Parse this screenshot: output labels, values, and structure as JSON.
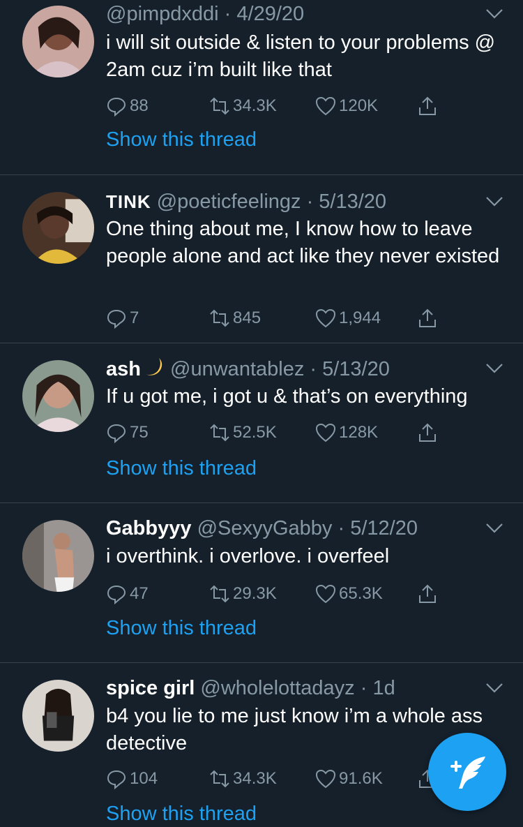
{
  "tweets": [
    {
      "name": "",
      "handle": "@pimpdxddi",
      "date": "4/29/20",
      "text": "i will sit outside & listen to your problems @ 2am cuz i’m built like that",
      "replies": "88",
      "retweets": "34.3K",
      "likes": "120K",
      "thread": "Show this thread"
    },
    {
      "name": "TINK",
      "handle": "@poeticfeelingz",
      "date": "5/13/20",
      "text": "One thing about me, I know how to leave people alone and act like they never existed",
      "replies": "7",
      "retweets": "845",
      "likes": "1,944",
      "thread": ""
    },
    {
      "name": "ash",
      "handle": "@unwantablez",
      "date": "5/13/20",
      "text": "If u got me, i got u & that’s on everything",
      "replies": "75",
      "retweets": "52.5K",
      "likes": "128K",
      "thread": "Show this thread"
    },
    {
      "name": "Gabbyyy",
      "handle": "@SexyyGabby",
      "date": "5/12/20",
      "text": "i overthink. i overlove. i overfeel",
      "replies": "47",
      "retweets": "29.3K",
      "likes": "65.3K",
      "thread": "Show this thread"
    },
    {
      "name": "spice girl",
      "handle": "@wholelottadayz",
      "date": "1d",
      "text": "b4 you lie to me just know i’m a whole ass detective",
      "replies": "104",
      "retweets": "34.3K",
      "likes": "91.6K",
      "thread": "Show this thread"
    }
  ],
  "separator": "·",
  "icons": {
    "reply": "reply-icon",
    "retweet": "retweet-icon",
    "like": "heart-icon",
    "share": "share-icon",
    "caret": "chevron-down-icon",
    "compose": "compose-tweet-icon",
    "moon": "crescent-moon-icon"
  },
  "colors": {
    "background": "#15202b",
    "divider": "#38444d",
    "secondary_text": "#8899a6",
    "accent": "#1da1f2"
  }
}
